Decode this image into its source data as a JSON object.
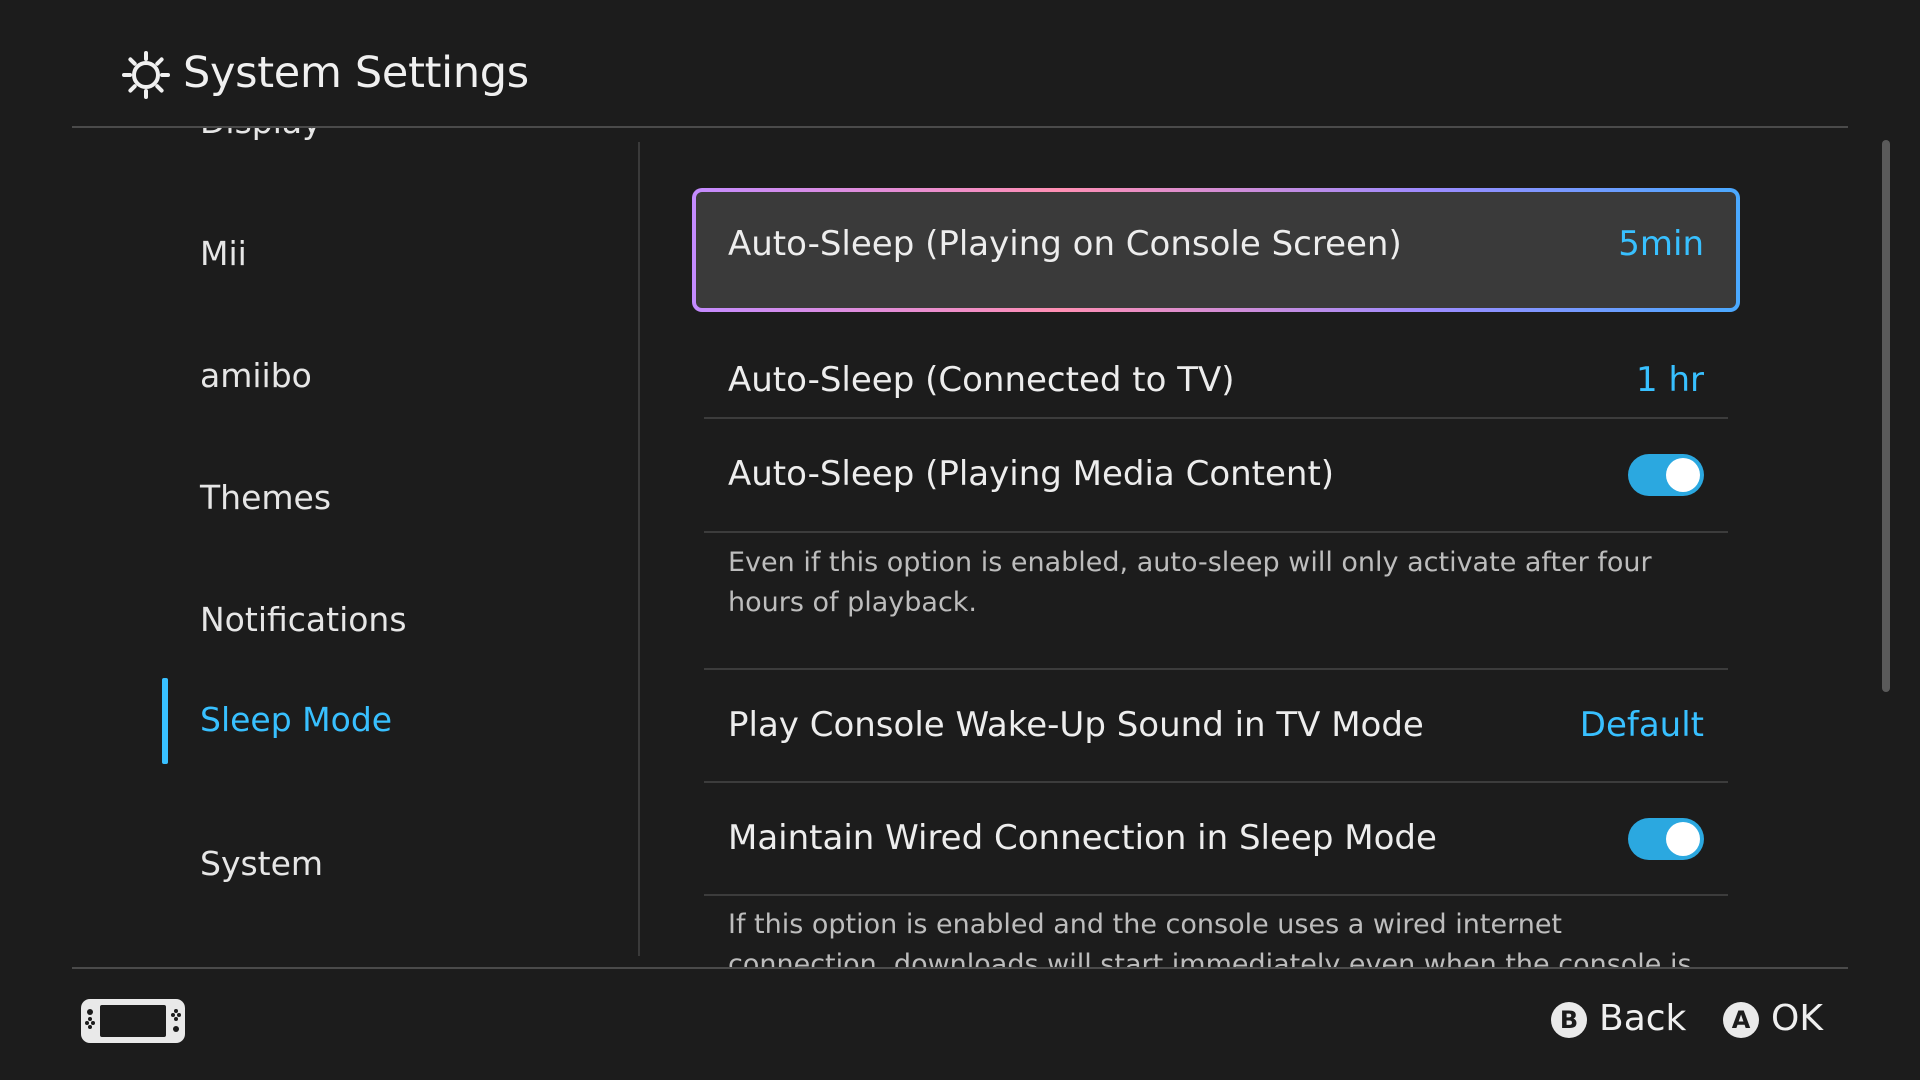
{
  "header": {
    "title": "System Settings",
    "icon": "gear-icon"
  },
  "sidebar": {
    "clipped_item": "Display",
    "items": [
      {
        "label": "Mii",
        "active": false
      },
      {
        "label": "amiibo",
        "active": false
      },
      {
        "label": "Themes",
        "active": false
      },
      {
        "label": "Notifications",
        "active": false
      },
      {
        "label": "Sleep Mode",
        "active": true
      },
      {
        "label": "System",
        "active": false
      }
    ]
  },
  "main": {
    "rows": [
      {
        "label": "Auto-Sleep (Playing on Console Screen)",
        "value": "5min",
        "focused": true
      },
      {
        "label": "Auto-Sleep (Connected to TV)",
        "value": "1 hr"
      },
      {
        "label": "Auto-Sleep (Playing Media Content)",
        "toggle": true
      },
      {
        "label": "Play Console Wake-Up Sound in TV Mode",
        "value": "Default"
      },
      {
        "label": "Maintain Wired Connection in Sleep Mode",
        "toggle": true
      }
    ],
    "descriptions": [
      "Even if this option is enabled, auto-sleep will only activate after four hours of playback.",
      "If this option is enabled and the console uses a wired internet connection, downloads will start immediately even when the console is in sleep mode."
    ]
  },
  "footer": {
    "back": {
      "glyph": "B",
      "label": "Back"
    },
    "ok": {
      "glyph": "A",
      "label": "OK"
    }
  },
  "colors": {
    "accent": "#38c0ff",
    "background": "#1c1c1c",
    "focus_row": "#3a3a3a",
    "toggle_on": "#2ba8e0"
  }
}
